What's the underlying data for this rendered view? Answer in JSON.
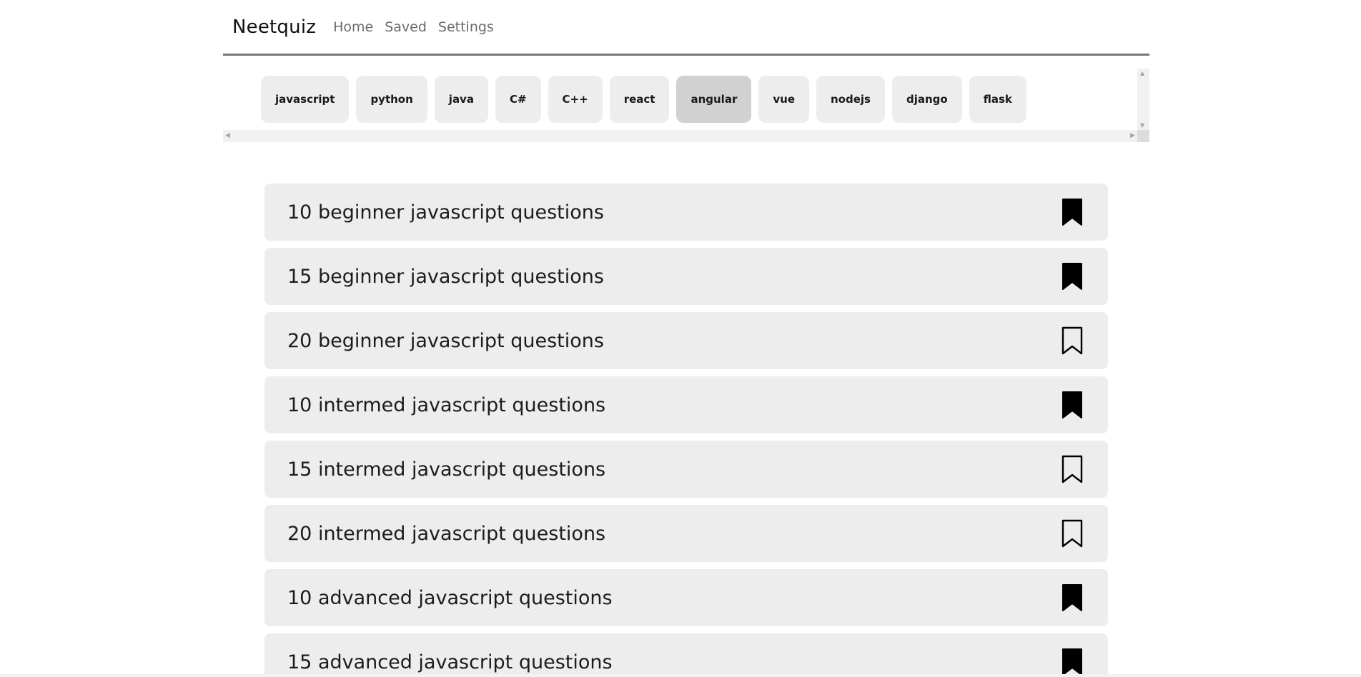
{
  "nav": {
    "brand": "Neetquiz",
    "links": [
      "Home",
      "Saved",
      "Settings"
    ]
  },
  "topics": {
    "items": [
      "javascript",
      "python",
      "java",
      "C#",
      "C++",
      "react",
      "angular",
      "vue",
      "nodejs",
      "django",
      "flask"
    ],
    "selected": "angular"
  },
  "quizzes": [
    {
      "title": "10 beginner javascript questions",
      "saved": true
    },
    {
      "title": "15 beginner javascript questions",
      "saved": true
    },
    {
      "title": "20 beginner javascript questions",
      "saved": false
    },
    {
      "title": "10 intermed javascript questions",
      "saved": true
    },
    {
      "title": "15 intermed javascript questions",
      "saved": false
    },
    {
      "title": "20 intermed javascript questions",
      "saved": false
    },
    {
      "title": "10 advanced javascript questions",
      "saved": true
    },
    {
      "title": "15 advanced javascript questions",
      "saved": true
    }
  ]
}
